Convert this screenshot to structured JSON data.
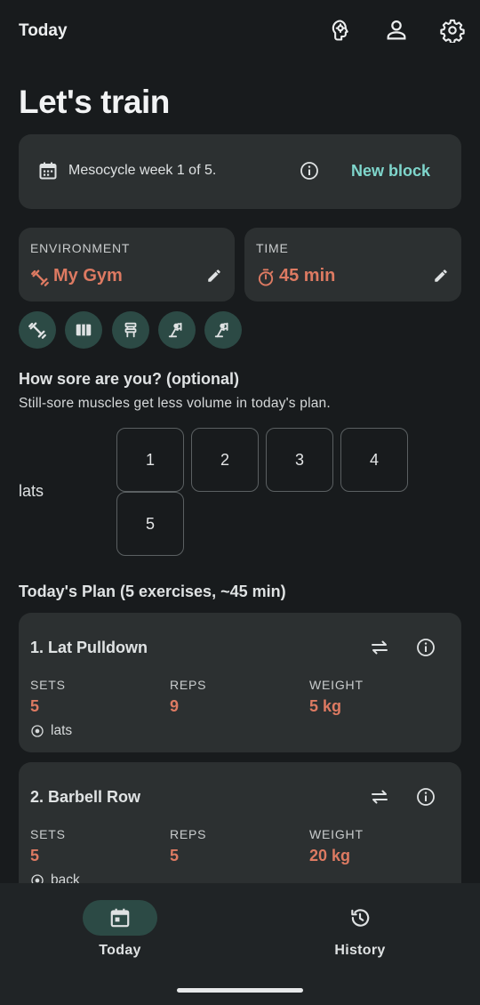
{
  "header": {
    "title": "Today",
    "icons": [
      "brain-icon",
      "person-icon",
      "settings-gear-icon"
    ]
  },
  "headline": "Let's train",
  "mesocycle": {
    "text": "Mesocycle week 1 of 5.",
    "new_block_label": "New block"
  },
  "environment": {
    "label": "ENVIRONMENT",
    "value": "My Gym"
  },
  "time": {
    "label": "TIME",
    "value": "45 min"
  },
  "equipment_chips": [
    "dumbbell-icon",
    "barbell-rack-icon",
    "bench-icon",
    "cable-machine-icon",
    "cable-machine-icon"
  ],
  "soreness": {
    "title": "How sore are you? (optional)",
    "subtitle": "Still-sore muscles get less volume in today's plan.",
    "muscle": "lats",
    "options": [
      "1",
      "2",
      "3",
      "4",
      "5"
    ]
  },
  "plan": {
    "title": "Today's Plan (5 exercises, ~45 min)",
    "columns": {
      "sets": "SETS",
      "reps": "REPS",
      "weight": "WEIGHT"
    },
    "exercises": [
      {
        "name": "1. Lat Pulldown",
        "sets": "5",
        "reps": "9",
        "weight": "5 kg",
        "muscle": "lats"
      },
      {
        "name": "2. Barbell Row",
        "sets": "5",
        "reps": "5",
        "weight": "20 kg",
        "muscle": "back"
      }
    ]
  },
  "bottom_nav": {
    "items": [
      {
        "label": "Today",
        "icon": "calendar-icon",
        "active": true
      },
      {
        "label": "History",
        "icon": "history-icon",
        "active": false
      }
    ]
  },
  "colors": {
    "background": "#181b1d",
    "card": "#2c3031",
    "accent_teal": "#7fd6cc",
    "accent_orange": "#dd7a62",
    "chip": "#2c4a45"
  }
}
